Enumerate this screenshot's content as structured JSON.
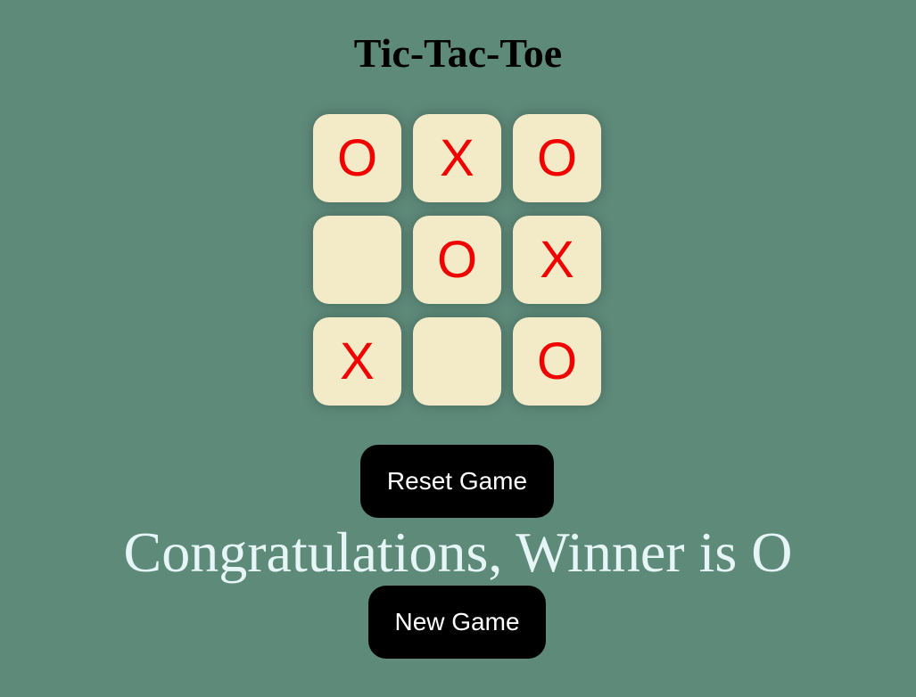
{
  "title": "Tic-Tac-Toe",
  "board": {
    "cells": [
      "O",
      "X",
      "O",
      "",
      "O",
      "X",
      "X",
      "",
      "O"
    ]
  },
  "buttons": {
    "reset_label": "Reset Game",
    "new_game_label": "New Game"
  },
  "message": "Congratulations, Winner is O",
  "colors": {
    "background": "#5e8a7a",
    "cell": "#f3ebc7",
    "mark": "#f20000",
    "button": "#000000",
    "button_text": "#ffffff",
    "message_text": "#e6f5f5"
  }
}
